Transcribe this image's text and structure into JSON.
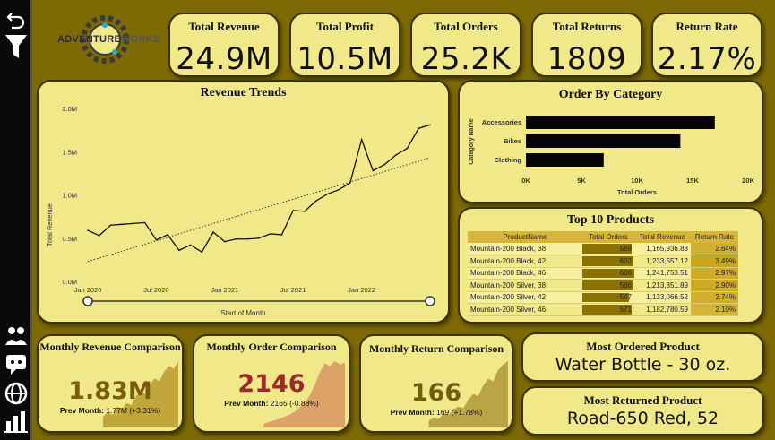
{
  "logo": {
    "text_left": "ADVENTURE",
    "text_right": "WORKS"
  },
  "sidebar": {
    "icons": [
      "back-icon",
      "filter-icon",
      "customers-icon",
      "reviews-icon",
      "globe-icon",
      "chart-icon"
    ]
  },
  "kpis": [
    {
      "title": "Total Revenue",
      "value": "24.9M"
    },
    {
      "title": "Total Profit",
      "value": "10.5M"
    },
    {
      "title": "Total Orders",
      "value": "25.2K"
    },
    {
      "title": "Total Returns",
      "value": "1809"
    },
    {
      "title": "Return Rate",
      "value": "2.17%"
    }
  ],
  "revenue_trends": {
    "title": "Revenue Trends",
    "slider_label": "Start of Month"
  },
  "order_by_category": {
    "title": "Order By Category"
  },
  "top10": {
    "title": "Top 10 Products",
    "columns": [
      "ProductName",
      "Total Orders",
      "Total Revenue",
      "Return Rate"
    ],
    "rows": [
      {
        "name": "Mountain-200 Black, 38",
        "orders": 569,
        "orders_text": "569",
        "revenue": "1,165,936.88",
        "rate": "2.64%",
        "rate_value": 2.64
      },
      {
        "name": "Mountain-200 Black, 42",
        "orders": 602,
        "orders_text": "602",
        "revenue": "1,233,557.12",
        "rate": "3.49%",
        "rate_value": 3.49
      },
      {
        "name": "Mountain-200 Black, 46",
        "orders": 606,
        "orders_text": "606",
        "revenue": "1,241,753.51",
        "rate": "2.97%",
        "rate_value": 2.97
      },
      {
        "name": "Mountain-200 Silver, 38",
        "orders": 586,
        "orders_text": "586",
        "revenue": "1,213,851.89",
        "rate": "2.90%",
        "rate_value": 2.9
      },
      {
        "name": "Mountain-200 Silver, 42",
        "orders": 547,
        "orders_text": "547",
        "revenue": "1,133,066.52",
        "rate": "2.74%",
        "rate_value": 2.74
      },
      {
        "name": "Mountain-200 Silver, 46",
        "orders": 571,
        "orders_text": "571",
        "revenue": "1,182,780.59",
        "rate": "2.10%",
        "rate_value": 2.1
      }
    ]
  },
  "comparisons": [
    {
      "title": "Monthly Revenue Comparison",
      "value": "1.83M",
      "prev_label": "Prev Month:",
      "prev_value": "1.77M",
      "prev_change": "(+3.31%)",
      "value_color": "#7a5c0e",
      "spark_color": "#b89a2e",
      "spark": [
        0.15,
        0.22,
        0.18,
        0.3,
        0.26,
        0.35,
        0.32,
        0.45,
        0.52,
        0.48,
        0.62,
        0.7,
        0.66,
        0.8,
        0.88,
        0.84,
        0.95
      ]
    },
    {
      "title": "Monthly Order Comparison",
      "value": "2146",
      "prev_label": "Prev Month:",
      "prev_value": "2165",
      "prev_change": "(-0.88%)",
      "value_color": "#9a2b2b",
      "spark_color": "#d89560",
      "spark": [
        0.05,
        0.08,
        0.1,
        0.12,
        0.15,
        0.18,
        0.22,
        0.28,
        0.35,
        0.45,
        0.6,
        0.78,
        0.92,
        0.88,
        0.95,
        0.9,
        0.93
      ]
    },
    {
      "title": "Monthly Return Comparison",
      "value": "166",
      "prev_label": "Prev Month:",
      "prev_value": "169",
      "prev_change": "(+1.78%)",
      "value_color": "#6f5d10",
      "spark_color": "#b0993a",
      "spark": [
        0.1,
        0.14,
        0.12,
        0.2,
        0.18,
        0.26,
        0.3,
        0.28,
        0.4,
        0.48,
        0.45,
        0.6,
        0.7,
        0.66,
        0.82,
        0.9,
        0.95
      ]
    }
  ],
  "most_ordered": {
    "title": "Most Ordered Product",
    "value": "Water Bottle - 30 oz."
  },
  "most_returned": {
    "title": "Most Returned Product",
    "value": "Road-650 Red, 52"
  },
  "chart_data": [
    {
      "type": "line",
      "title": "Revenue Trends",
      "xlabel": "",
      "ylabel": "Total Revenue",
      "x_ticks": [
        "Jan 2020",
        "Jul 2020",
        "Jan 2021",
        "Jul 2021",
        "Jan 2022"
      ],
      "y_ticks": [
        "0.0M",
        "0.5M",
        "1.0M",
        "1.5M",
        "2.0M"
      ],
      "ylim": [
        0,
        2.0
      ],
      "x": [
        "2020-01",
        "2020-02",
        "2020-03",
        "2020-04",
        "2020-05",
        "2020-06",
        "2020-07",
        "2020-08",
        "2020-09",
        "2020-10",
        "2020-11",
        "2020-12",
        "2021-01",
        "2021-02",
        "2021-03",
        "2021-04",
        "2021-05",
        "2021-06",
        "2021-07",
        "2021-08",
        "2021-09",
        "2021-10",
        "2021-11",
        "2021-12",
        "2022-01",
        "2022-02",
        "2022-03",
        "2022-04",
        "2022-05",
        "2022-06"
      ],
      "series": [
        {
          "values": [
            0.59,
            0.53,
            0.65,
            0.66,
            0.67,
            0.68,
            0.48,
            0.54,
            0.36,
            0.42,
            0.34,
            0.57,
            0.46,
            0.49,
            0.49,
            0.5,
            0.55,
            0.54,
            0.82,
            0.81,
            0.93,
            1.01,
            1.06,
            1.14,
            1.64,
            1.28,
            1.35,
            1.46,
            1.54,
            1.77,
            1.81
          ]
        }
      ],
      "trendline": {
        "start": 0.23,
        "end": 1.43,
        "style": "dotted"
      },
      "grid": false
    },
    {
      "type": "bar",
      "orientation": "horizontal",
      "title": "Order By Category",
      "xlabel": "Total Orders",
      "ylabel": "Category Name",
      "categories": [
        "Accessories",
        "Bikes",
        "Clothing"
      ],
      "values": [
        17000,
        13900,
        7000
      ],
      "x_ticks": [
        "0K",
        "5K",
        "10K",
        "15K",
        "20K"
      ],
      "xlim": [
        0,
        20000
      ],
      "grid": false
    }
  ]
}
